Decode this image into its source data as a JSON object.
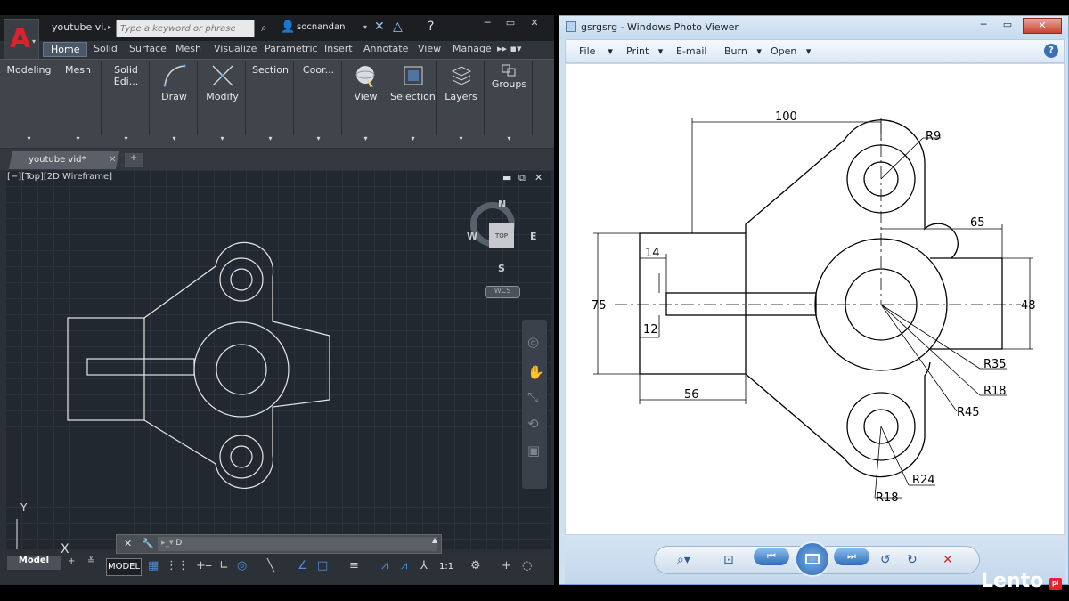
{
  "acad": {
    "title": "youtube vi...",
    "search_placeholder": "Type a keyword or phrase",
    "user": "socnandan",
    "ribbon_tabs": [
      "Home",
      "Solid",
      "Surface",
      "Mesh",
      "Visualize",
      "Parametric",
      "Insert",
      "Annotate",
      "View",
      "Manage"
    ],
    "panels": [
      "Modeling",
      "Mesh",
      "Solid Edi...",
      "Draw",
      "Modify",
      "Section",
      "Coor...",
      "View",
      "Selection",
      "Layers",
      "Groups"
    ],
    "doc_tab": "youtube vid*",
    "viewport_label": "[−][Top][2D Wireframe]",
    "compass": {
      "n": "N",
      "s": "S",
      "e": "E",
      "w": "W"
    },
    "cube_label": "TOP",
    "wcs": "WCS",
    "ucs": {
      "x": "X",
      "y": "Y"
    },
    "command_input": "D",
    "model_tab": "Model",
    "model_button": "MODEL",
    "scale": "1:1"
  },
  "viewer": {
    "title": "gsrgsrg - Windows Photo Viewer",
    "menu": [
      "File",
      "Print",
      "E-mail",
      "Burn",
      "Open"
    ],
    "help": "?"
  },
  "drawing": {
    "dims": {
      "d100": "100",
      "r9": "R9",
      "d65": "65",
      "d14": "14",
      "d75": "75",
      "d48": "48",
      "d12": "12",
      "d56": "56",
      "r35": "R35",
      "r18a": "R18",
      "r45": "R45",
      "r24": "R24",
      "r18b": "R18"
    }
  },
  "watermark": {
    "text": "Lento",
    "badge": "pl"
  }
}
